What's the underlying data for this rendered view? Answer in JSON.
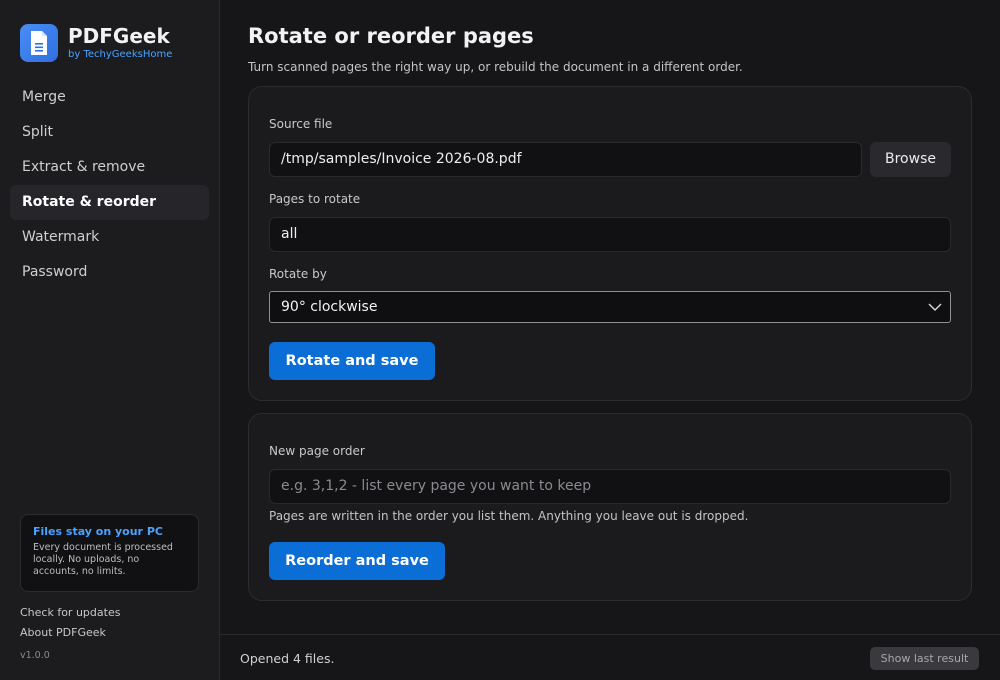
{
  "brand": {
    "name": "PDFGeek",
    "by": "by TechyGeeksHome",
    "logo_icon": "document-icon",
    "accent": "#4aa3ff"
  },
  "sidebar": {
    "items": [
      {
        "label": "Merge",
        "active": false
      },
      {
        "label": "Split",
        "active": false
      },
      {
        "label": "Extract & remove",
        "active": false
      },
      {
        "label": "Rotate & reorder",
        "active": true
      },
      {
        "label": "Watermark",
        "active": false
      },
      {
        "label": "Password",
        "active": false
      }
    ],
    "privacy": {
      "title": "Files stay on your PC",
      "text": "Every document is processed locally. No uploads, no accounts, no limits."
    },
    "check_updates": "Check for updates",
    "about": "About PDFGeek",
    "version": "v1.0.0"
  },
  "main": {
    "title": "Rotate or reorder pages",
    "subtitle": "Turn scanned pages the right way up, or rebuild the document in a different order.",
    "rotate_card": {
      "source_label": "Source file",
      "source_value": "/tmp/samples/Invoice 2026-08.pdf",
      "browse_label": "Browse",
      "pages_label": "Pages to rotate",
      "pages_value": "all",
      "rotate_by_label": "Rotate by",
      "rotate_by_value": "90° clockwise",
      "submit_label": "Rotate and save"
    },
    "reorder_card": {
      "order_label": "New page order",
      "order_placeholder": "e.g. 3,1,2 - list every page you want to keep",
      "help_text": "Pages are written in the order you list them. Anything you leave out is dropped.",
      "submit_label": "Reorder and save"
    }
  },
  "status": {
    "text": "Opened 4 files.",
    "show_last_label": "Show last result"
  },
  "colors": {
    "primary_button": "#0b6ed6",
    "background": "#161618",
    "sidebar": "#1c1c1f"
  }
}
